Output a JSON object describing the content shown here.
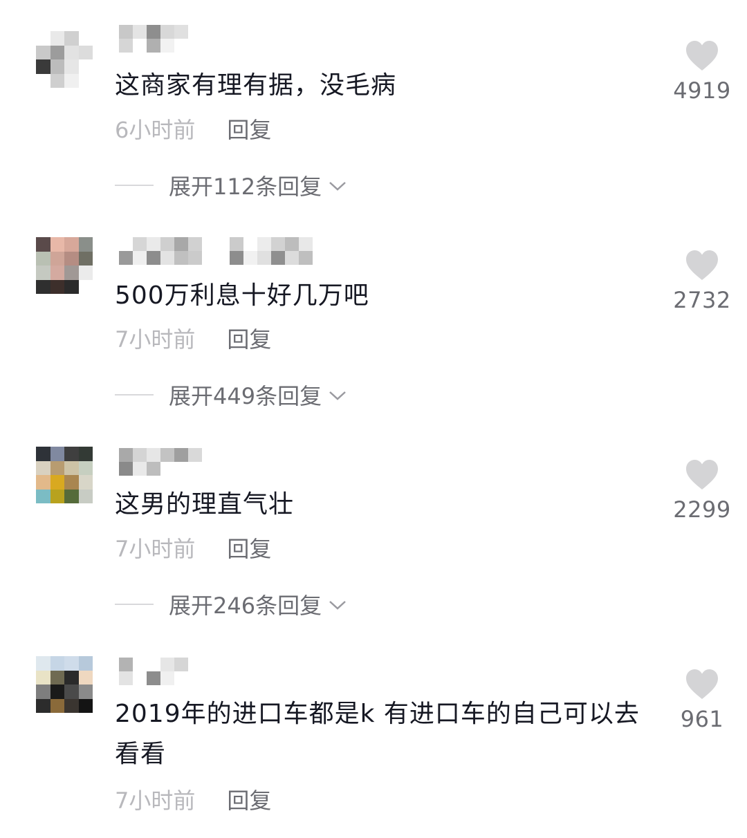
{
  "comments": [
    {
      "text": "这商家有理有据，没毛病",
      "time": "6小时前",
      "reply_label": "回复",
      "expand_label": "展开112条回复",
      "likes": "4919"
    },
    {
      "text": "500万利息十好几万吧",
      "time": "7小时前",
      "reply_label": "回复",
      "expand_label": "展开449条回复",
      "likes": "2732"
    },
    {
      "text": "这男的理直气壮",
      "time": "7小时前",
      "reply_label": "回复",
      "expand_label": "展开246条回复",
      "likes": "2299"
    },
    {
      "text": "2019年的进口车都是k 有进口车的自己可以去看看",
      "time": "7小时前",
      "reply_label": "回复",
      "likes": "961"
    }
  ],
  "icons": {
    "heart": "heart-icon",
    "chevron": "chevron-down-icon"
  },
  "colors": {
    "text": "#161823",
    "meta": "#b8b8bc",
    "secondary": "#6b6c72",
    "heart": "#d4d4d6"
  }
}
